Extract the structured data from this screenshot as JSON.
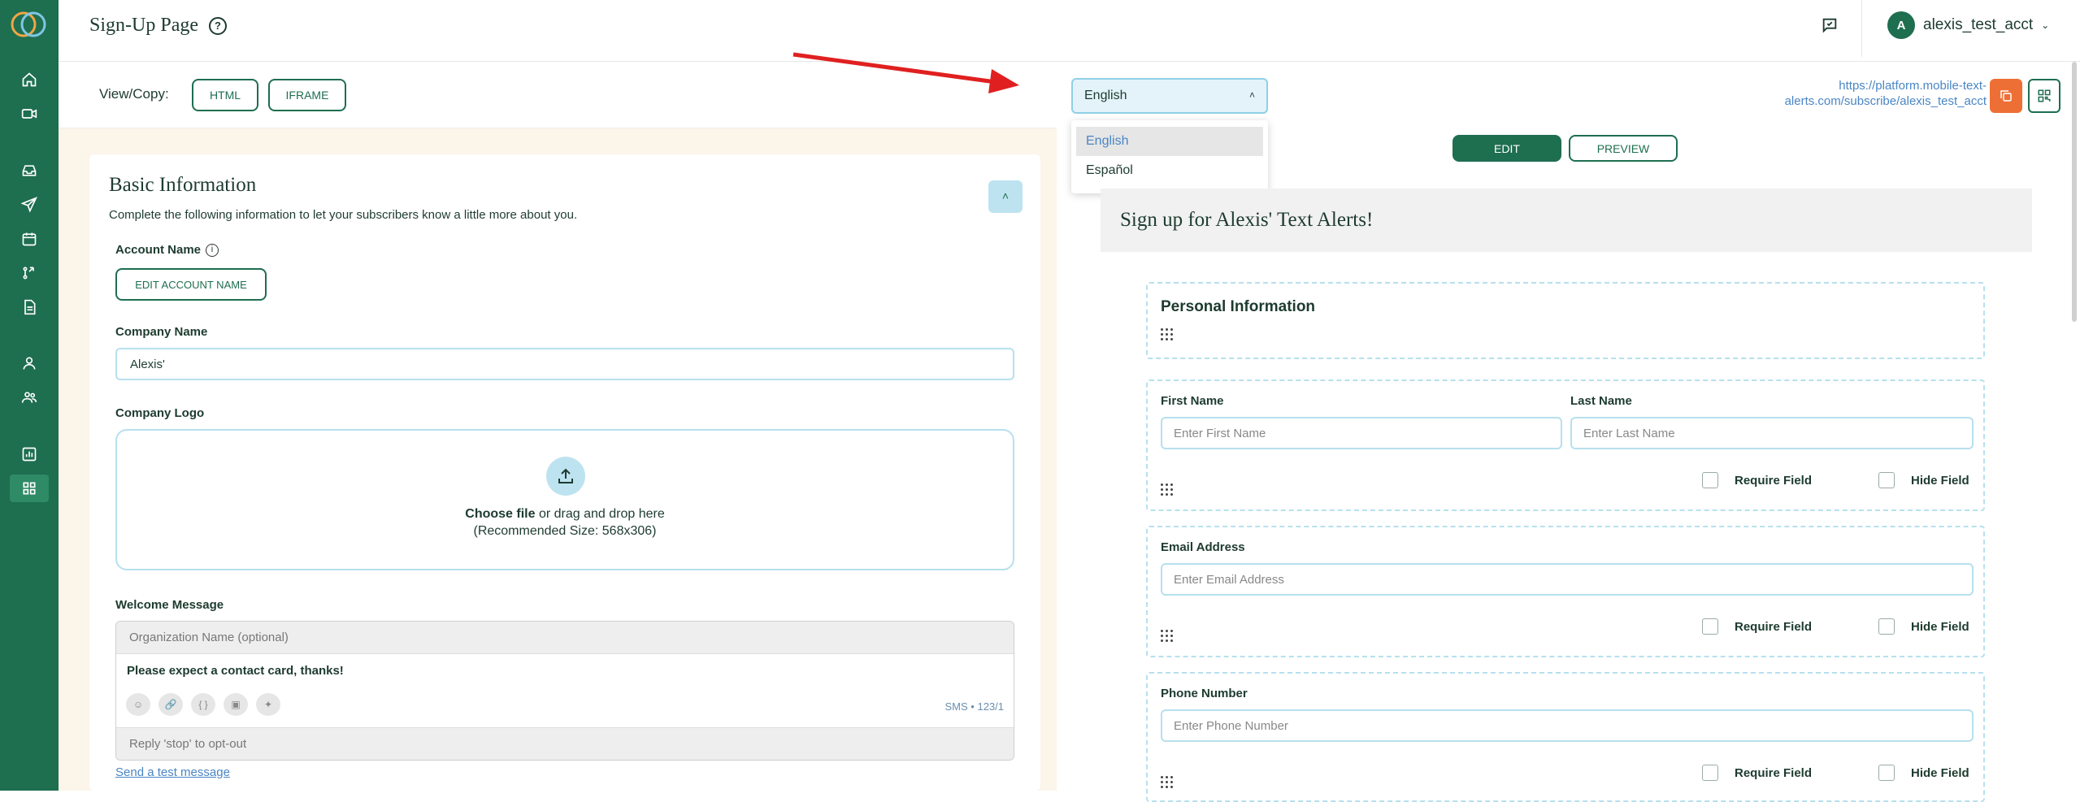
{
  "header": {
    "title": "Sign-Up Page",
    "account_initial": "A",
    "account_name": "alexis_test_acct"
  },
  "viewcopy": {
    "label": "View/Copy:",
    "html_btn": "HTML",
    "iframe_btn": "IFRAME"
  },
  "basic_info": {
    "title": "Basic Information",
    "subtitle": "Complete the following information to let your subscribers know a little more about you.",
    "account_name_label": "Account Name",
    "edit_account_btn": "EDIT ACCOUNT NAME",
    "company_name_label": "Company Name",
    "company_name_value": "Alexis'",
    "company_logo_label": "Company Logo",
    "upload_choose": "Choose file",
    "upload_rest": " or drag and drop here",
    "upload_size": "(Recommended Size: 568x306)",
    "welcome_label": "Welcome Message",
    "org_placeholder": "Organization Name (optional)",
    "message_text": "Please expect a contact card, thanks!",
    "sms_count": "SMS • 123/1",
    "reply_text": "Reply 'stop' to opt-out",
    "test_link": "Send a test message"
  },
  "language": {
    "selected": "English",
    "options": [
      "English",
      "Español"
    ]
  },
  "signup_url": "https://platform.mobile-text-alerts.com/subscribe/alexis_test_acct",
  "preview": {
    "edit_btn": "EDIT",
    "preview_btn": "PREVIEW",
    "form_title": "Sign up for Alexis' Text Alerts!",
    "section_title": "Personal Information",
    "first_name_label": "First Name",
    "first_name_placeholder": "Enter First Name",
    "last_name_label": "Last Name",
    "last_name_placeholder": "Enter Last Name",
    "email_label": "Email Address",
    "email_placeholder": "Enter Email Address",
    "phone_label": "Phone Number",
    "phone_placeholder": "Enter Phone Number",
    "require_field": "Require Field",
    "hide_field": "Hide Field"
  },
  "colors": {
    "brand_green": "#1e6e50",
    "accent_blue": "#b7e0ee",
    "copy_orange": "#ee6f36",
    "arrow_red": "#e02020"
  }
}
